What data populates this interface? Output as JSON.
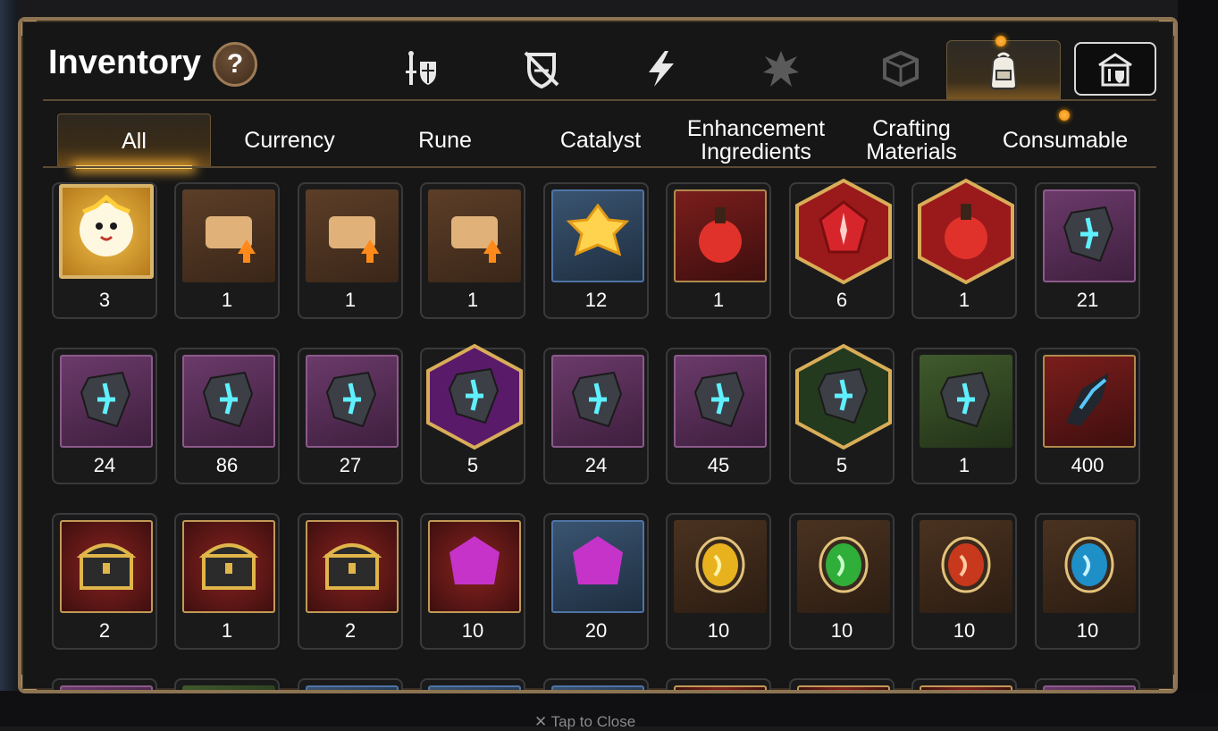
{
  "background": {
    "tap_to_close": "✕ Tap to Close"
  },
  "header": {
    "title": "Inventory",
    "help_label": "?"
  },
  "category_tabs": [
    {
      "icon": "knight-shield-icon",
      "state": "normal"
    },
    {
      "icon": "broken-shield-icon",
      "state": "normal"
    },
    {
      "icon": "lightning-icon",
      "state": "normal"
    },
    {
      "icon": "shattered-crystal-icon",
      "state": "dim"
    },
    {
      "icon": "cube-icon",
      "state": "dim"
    },
    {
      "icon": "backpack-icon",
      "state": "active"
    },
    {
      "icon": "armory-icon",
      "state": "boxed"
    }
  ],
  "sub_tabs": [
    {
      "label": "All",
      "active": true
    },
    {
      "label": "Currency",
      "active": false
    },
    {
      "label": "Rune",
      "active": false
    },
    {
      "label": "Catalyst",
      "active": false
    },
    {
      "label": "Enhancement Ingredients",
      "active": false
    },
    {
      "label": "Crafting Materials",
      "active": false
    },
    {
      "label": "Consumable",
      "active": false
    }
  ],
  "items": [
    {
      "name": "mascot-coin",
      "count": "3",
      "frame": "circle",
      "icon": "mascot-icon"
    },
    {
      "name": "upgrade-scroll-red",
      "count": "1",
      "frame": "brown",
      "icon": "scroll-icon"
    },
    {
      "name": "upgrade-scroll-rainbow",
      "count": "1",
      "frame": "brown",
      "icon": "scroll-icon"
    },
    {
      "name": "upgrade-scroll-gold",
      "count": "1",
      "frame": "brown",
      "icon": "scroll-icon"
    },
    {
      "name": "gold-crystal-cluster",
      "count": "12",
      "frame": "blue",
      "icon": "crystal-cluster-icon"
    },
    {
      "name": "red-potion-flask",
      "count": "1",
      "frame": "red",
      "icon": "flask-icon"
    },
    {
      "name": "red-rune-gem",
      "count": "6",
      "frame": "hex-red",
      "icon": "gem-icon"
    },
    {
      "name": "pink-potion-flask",
      "count": "1",
      "frame": "hex-red",
      "icon": "flask-icon"
    },
    {
      "name": "rune-stone-armor",
      "count": "21",
      "frame": "purple",
      "icon": "rune-stone-icon"
    },
    {
      "name": "rune-stone-boots",
      "count": "24",
      "frame": "purple",
      "icon": "rune-stone-icon"
    },
    {
      "name": "rune-stone-hammer",
      "count": "86",
      "frame": "purple",
      "icon": "rune-stone-icon"
    },
    {
      "name": "rune-stone-swirl",
      "count": "27",
      "frame": "purple",
      "icon": "rune-stone-icon"
    },
    {
      "name": "rune-stone-star-hex",
      "count": "5",
      "frame": "hex-purple",
      "icon": "rune-stone-icon"
    },
    {
      "name": "rune-stone-sword",
      "count": "24",
      "frame": "purple",
      "icon": "rune-stone-icon"
    },
    {
      "name": "rune-stone-dagger",
      "count": "45",
      "frame": "purple",
      "icon": "rune-stone-icon"
    },
    {
      "name": "white-rune-star-hex",
      "count": "5",
      "frame": "hex-green",
      "icon": "rune-stone-icon"
    },
    {
      "name": "white-rune-sword",
      "count": "1",
      "frame": "green",
      "icon": "rune-stone-icon"
    },
    {
      "name": "dark-shard",
      "count": "400",
      "frame": "red",
      "icon": "shard-icon"
    },
    {
      "name": "blue-treasure-chest",
      "count": "2",
      "frame": "redgold",
      "icon": "chest-icon"
    },
    {
      "name": "gold-chest-1",
      "count": "1",
      "frame": "redgold",
      "icon": "chest-icon"
    },
    {
      "name": "gold-chest-2",
      "count": "2",
      "frame": "redgold",
      "icon": "chest-icon"
    },
    {
      "name": "moon-gem-pentagon",
      "count": "10",
      "frame": "redgold",
      "icon": "moon-gem-icon"
    },
    {
      "name": "moon-gem-triangle",
      "count": "20",
      "frame": "blue",
      "icon": "moon-gem-icon"
    },
    {
      "name": "yellow-orb",
      "count": "10",
      "frame": "brownplain",
      "icon": "orb-icon"
    },
    {
      "name": "green-orb",
      "count": "10",
      "frame": "brownplain",
      "icon": "orb-icon"
    },
    {
      "name": "red-orb",
      "count": "10",
      "frame": "brownplain",
      "icon": "orb-icon"
    },
    {
      "name": "blue-orb",
      "count": "10",
      "frame": "brownplain",
      "icon": "orb-icon"
    }
  ],
  "colors": {
    "panel_border": "#8c7452",
    "accent_gold": "#ffcf6b",
    "notification": "#f5a021"
  }
}
